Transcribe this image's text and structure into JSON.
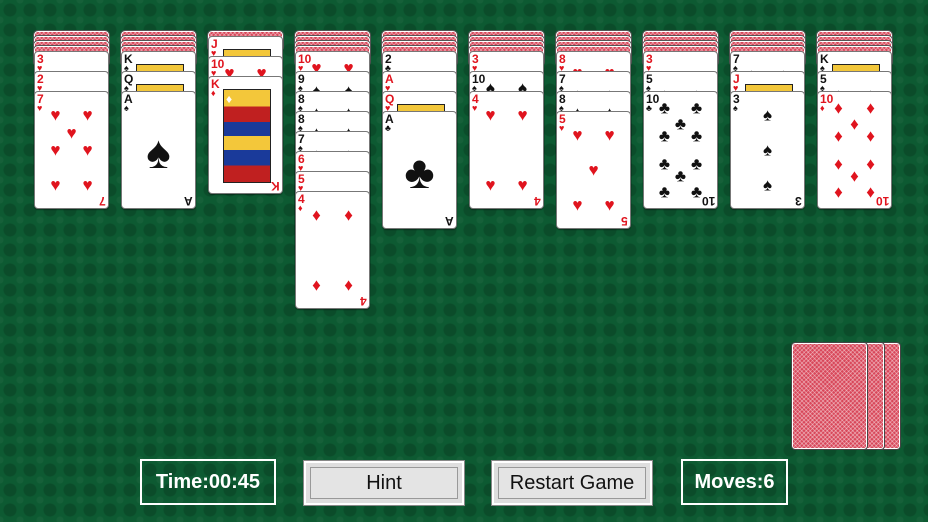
{
  "suits": {
    "S": "♠",
    "H": "♥",
    "D": "♦",
    "C": "♣"
  },
  "columns": [
    {
      "backs": 4,
      "up": [
        {
          "r": "3",
          "s": "H"
        },
        {
          "r": "2",
          "s": "H"
        },
        {
          "r": "7",
          "s": "H"
        }
      ]
    },
    {
      "backs": 4,
      "up": [
        {
          "r": "K",
          "s": "S"
        },
        {
          "r": "Q",
          "s": "S"
        },
        {
          "r": "A",
          "s": "S"
        }
      ]
    },
    {
      "backs": 1,
      "up": [
        {
          "r": "J",
          "s": "H"
        },
        {
          "r": "10",
          "s": "H"
        },
        {
          "r": "K",
          "s": "D"
        }
      ]
    },
    {
      "backs": 4,
      "up": [
        {
          "r": "10",
          "s": "H"
        },
        {
          "r": "9",
          "s": "S"
        },
        {
          "r": "8",
          "s": "S"
        },
        {
          "r": "8",
          "s": "S"
        },
        {
          "r": "7",
          "s": "S"
        },
        {
          "r": "6",
          "s": "H"
        },
        {
          "r": "5",
          "s": "H"
        },
        {
          "r": "4",
          "s": "D"
        }
      ]
    },
    {
      "backs": 4,
      "up": [
        {
          "r": "2",
          "s": "C"
        },
        {
          "r": "A",
          "s": "H"
        },
        {
          "r": "Q",
          "s": "H"
        },
        {
          "r": "A",
          "s": "C"
        }
      ]
    },
    {
      "backs": 4,
      "up": [
        {
          "r": "3",
          "s": "H"
        },
        {
          "r": "10",
          "s": "S"
        },
        {
          "r": "4",
          "s": "H"
        }
      ]
    },
    {
      "backs": 4,
      "up": [
        {
          "r": "8",
          "s": "H"
        },
        {
          "r": "7",
          "s": "S"
        },
        {
          "r": "8",
          "s": "S"
        },
        {
          "r": "5",
          "s": "H"
        }
      ]
    },
    {
      "backs": 4,
      "up": [
        {
          "r": "3",
          "s": "H"
        },
        {
          "r": "5",
          "s": "S"
        },
        {
          "r": "10",
          "s": "C"
        }
      ]
    },
    {
      "backs": 4,
      "up": [
        {
          "r": "7",
          "s": "S"
        },
        {
          "r": "J",
          "s": "H"
        },
        {
          "r": "3",
          "s": "S"
        }
      ]
    },
    {
      "backs": 4,
      "up": [
        {
          "r": "K",
          "s": "S"
        },
        {
          "r": "5",
          "s": "S"
        },
        {
          "r": "10",
          "s": "D"
        }
      ]
    }
  ],
  "stock_piles": 3,
  "footer": {
    "time": "Time:00:45",
    "hint": "Hint",
    "restart": "Restart Game",
    "moves": "Moves:6"
  }
}
